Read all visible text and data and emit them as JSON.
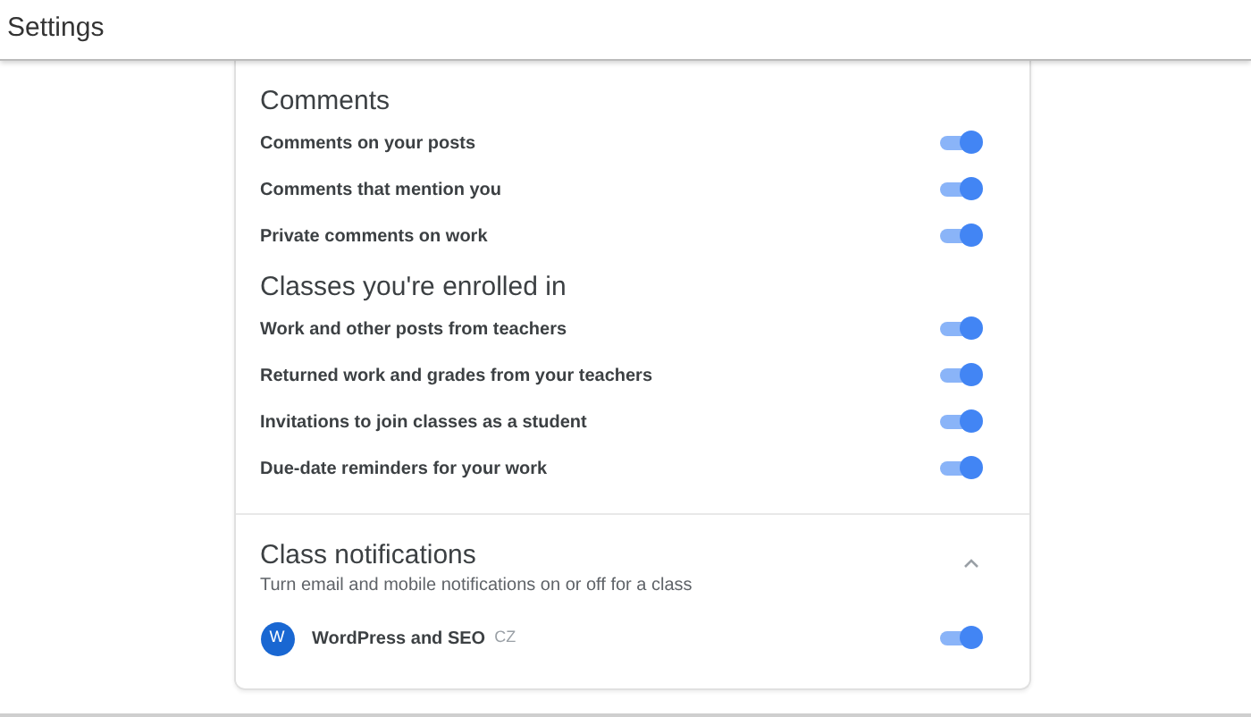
{
  "header": {
    "title": "Settings"
  },
  "sections": [
    {
      "title": "Comments",
      "items": [
        {
          "label": "Comments on your posts",
          "on": true
        },
        {
          "label": "Comments that mention you",
          "on": true
        },
        {
          "label": "Private comments on work",
          "on": true
        }
      ]
    },
    {
      "title": "Classes you're enrolled in",
      "items": [
        {
          "label": "Work and other posts from teachers",
          "on": true
        },
        {
          "label": "Returned work and grades from your teachers",
          "on": true
        },
        {
          "label": "Invitations to join classes as a student",
          "on": true
        },
        {
          "label": "Due-date reminders for your work",
          "on": true
        }
      ]
    }
  ],
  "class_notifications": {
    "title": "Class notifications",
    "subtitle": "Turn email and mobile notifications on or off for a class",
    "expanded": true,
    "classes": [
      {
        "initial": "W",
        "name": "WordPress and SEO",
        "section": "CZ",
        "on": true
      }
    ]
  }
}
